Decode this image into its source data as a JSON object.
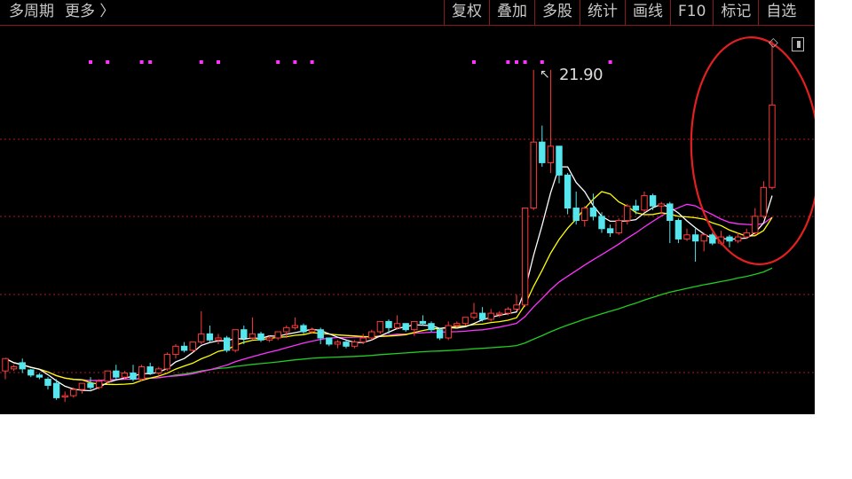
{
  "toolbar": {
    "left_items": [
      "多周期",
      "更多 〉"
    ],
    "right_items": [
      "复权",
      "叠加",
      "多股",
      "统计",
      "画线",
      "F10",
      "标记",
      "自选"
    ]
  },
  "peak_label": "21.90",
  "peak_arrow": "↖",
  "colors": {
    "background": "#000000",
    "up": "#ff3b3b",
    "down": "#55e6ee",
    "ma5": "#ffffff",
    "ma10": "#ffff00",
    "ma20": "#ff33ff",
    "ma60": "#22cc22",
    "grid": "#b01818",
    "marker": "#ff33ff",
    "annotation": "#e32020"
  },
  "chart_data": {
    "type": "candlestick",
    "grid": "horizontal dotted",
    "peak_value": 21.9,
    "ylim": [
      5.2,
      24.0
    ],
    "series_lines": [
      "MA5",
      "MA10",
      "MA20",
      "MA60"
    ],
    "candles": [
      [
        7.3,
        7.9,
        7.7,
        6.9
      ],
      [
        7.4,
        7.5,
        7.6,
        7.3
      ],
      [
        7.7,
        7.4,
        7.9,
        7.2
      ],
      [
        7.35,
        7.1,
        7.4,
        7.0
      ],
      [
        7.1,
        7.0,
        7.2,
        6.9
      ],
      [
        6.9,
        6.6,
        7.0,
        6.4
      ],
      [
        6.7,
        6.0,
        6.9,
        5.9
      ],
      [
        6.1,
        6.1,
        6.3,
        5.8
      ],
      [
        6.1,
        6.4,
        6.5,
        6.0
      ],
      [
        6.4,
        6.7,
        6.7,
        6.2
      ],
      [
        6.7,
        6.5,
        7.0,
        6.4
      ],
      [
        6.5,
        6.8,
        6.9,
        6.4
      ],
      [
        6.8,
        7.3,
        7.3,
        6.7
      ],
      [
        7.3,
        7.0,
        7.6,
        6.9
      ],
      [
        7.0,
        7.2,
        7.3,
        6.9
      ],
      [
        7.2,
        6.9,
        7.6,
        6.8
      ],
      [
        6.9,
        7.5,
        7.6,
        6.8
      ],
      [
        7.5,
        7.2,
        7.7,
        7.1
      ],
      [
        7.2,
        7.4,
        7.5,
        7.1
      ],
      [
        7.4,
        8.1,
        8.2,
        7.3
      ],
      [
        8.1,
        8.5,
        8.6,
        7.9
      ],
      [
        8.5,
        8.3,
        8.7,
        8.2
      ],
      [
        8.3,
        8.7,
        8.7,
        8.2
      ],
      [
        8.7,
        9.1,
        10.2,
        8.6
      ],
      [
        9.1,
        8.8,
        9.5,
        8.7
      ],
      [
        8.8,
        8.9,
        9.1,
        8.6
      ],
      [
        8.9,
        8.3,
        9.0,
        8.2
      ],
      [
        8.3,
        9.3,
        9.3,
        8.2
      ],
      [
        9.3,
        8.9,
        9.5,
        8.6
      ],
      [
        8.9,
        9.1,
        9.9,
        8.8
      ],
      [
        9.1,
        8.8,
        9.2,
        8.7
      ],
      [
        8.8,
        8.9,
        9.0,
        8.7
      ],
      [
        8.9,
        9.2,
        9.2,
        8.8
      ],
      [
        9.2,
        9.4,
        9.5,
        8.9
      ],
      [
        9.4,
        9.5,
        9.9,
        9.3
      ],
      [
        9.5,
        9.2,
        9.6,
        9.1
      ],
      [
        9.2,
        9.3,
        9.4,
        9.1
      ],
      [
        9.3,
        8.9,
        9.4,
        8.6
      ],
      [
        8.9,
        8.6,
        8.9,
        8.5
      ],
      [
        8.6,
        8.7,
        8.8,
        8.4
      ],
      [
        8.7,
        8.5,
        8.8,
        8.4
      ],
      [
        8.5,
        8.7,
        8.8,
        8.4
      ],
      [
        8.7,
        8.9,
        9.1,
        8.6
      ],
      [
        8.9,
        9.2,
        9.3,
        8.8
      ],
      [
        9.2,
        9.7,
        9.7,
        9.1
      ],
      [
        9.7,
        9.4,
        9.8,
        9.1
      ],
      [
        9.4,
        9.6,
        10.0,
        9.3
      ],
      [
        9.6,
        9.3,
        9.6,
        9.2
      ],
      [
        9.3,
        9.7,
        9.7,
        9.0
      ],
      [
        9.7,
        9.6,
        10.0,
        9.5
      ],
      [
        9.6,
        9.3,
        9.7,
        9.2
      ],
      [
        9.3,
        8.9,
        9.4,
        8.8
      ],
      [
        8.9,
        9.5,
        9.7,
        8.8
      ],
      [
        9.5,
        9.6,
        9.7,
        9.4
      ],
      [
        9.6,
        9.9,
        9.9,
        9.5
      ],
      [
        9.9,
        10.1,
        10.6,
        9.8
      ],
      [
        10.1,
        9.8,
        10.4,
        9.7
      ],
      [
        9.8,
        10.1,
        10.3,
        9.7
      ],
      [
        10.1,
        10.1,
        10.2,
        9.9
      ],
      [
        10.1,
        10.3,
        10.4,
        10.0
      ],
      [
        10.3,
        10.5,
        11.0,
        10.2
      ],
      [
        10.5,
        15.2,
        15.2,
        10.4
      ],
      [
        15.2,
        18.4,
        21.9,
        15.1
      ],
      [
        18.4,
        17.4,
        19.2,
        17.2
      ],
      [
        17.4,
        18.2,
        21.9,
        16.9
      ],
      [
        18.2,
        16.8,
        18.2,
        16.4
      ],
      [
        16.8,
        15.2,
        16.9,
        14.9
      ],
      [
        15.2,
        14.6,
        16.0,
        14.4
      ],
      [
        14.6,
        15.2,
        15.3,
        14.3
      ],
      [
        15.2,
        14.8,
        15.9,
        14.6
      ],
      [
        14.8,
        14.2,
        15.0,
        14.0
      ],
      [
        14.2,
        14.0,
        14.4,
        13.8
      ],
      [
        14.0,
        14.6,
        14.7,
        13.9
      ],
      [
        14.6,
        15.3,
        15.4,
        14.4
      ],
      [
        15.3,
        15.1,
        15.6,
        14.9
      ],
      [
        15.1,
        15.8,
        16.0,
        15.0
      ],
      [
        15.8,
        15.3,
        15.9,
        15.1
      ],
      [
        15.3,
        15.4,
        15.5,
        14.9
      ],
      [
        15.4,
        14.6,
        15.5,
        13.5
      ],
      [
        14.6,
        13.7,
        14.7,
        13.5
      ],
      [
        13.7,
        13.9,
        14.2,
        13.6
      ],
      [
        13.9,
        13.6,
        14.2,
        12.6
      ],
      [
        13.6,
        13.9,
        14.0,
        13.1
      ],
      [
        13.9,
        13.5,
        14.0,
        13.4
      ],
      [
        13.5,
        13.8,
        14.1,
        13.4
      ],
      [
        13.8,
        13.6,
        13.9,
        13.3
      ],
      [
        13.6,
        13.8,
        14.0,
        13.5
      ],
      [
        13.8,
        14.0,
        14.2,
        13.7
      ],
      [
        14.0,
        14.8,
        15.2,
        13.9
      ],
      [
        14.8,
        16.2,
        16.5,
        14.7
      ],
      [
        16.2,
        20.2,
        23.3,
        16.1
      ]
    ],
    "markers": [
      10,
      12,
      16,
      17,
      23,
      25,
      32,
      34,
      36,
      55,
      59,
      60,
      61,
      63,
      71
    ]
  }
}
